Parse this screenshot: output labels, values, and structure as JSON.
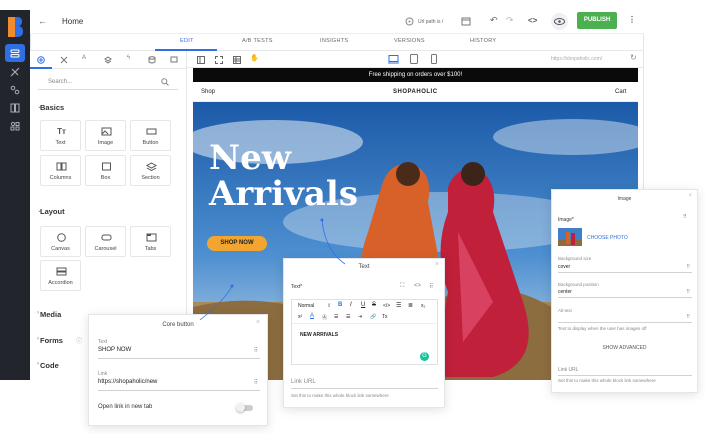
{
  "topbar": {
    "back_arrow": "←",
    "home": "Home",
    "url_path": "Url path is /",
    "publish": "PUBLISH"
  },
  "tabs": [
    "EDIT",
    "A/B TESTS",
    "INSIGHTS",
    "VERSIONS",
    "HISTORY"
  ],
  "preview_url": "https://shopaholic.com/",
  "search": {
    "placeholder": "Search..."
  },
  "basics": {
    "title": "Basics",
    "items": [
      "Text",
      "Image",
      "Button",
      "Columns",
      "Box",
      "Section"
    ]
  },
  "layout": {
    "title": "Layout",
    "items": [
      "Canvas",
      "Carousel",
      "Tabs",
      "Accordion"
    ]
  },
  "sections": [
    "Media",
    "Forms",
    "Code"
  ],
  "site": {
    "banner": "Free shipping on orders over $100!",
    "nav_left": "Shop",
    "brand": "SHOPAHOLIC",
    "nav_right": "Cart",
    "headline_1": "New",
    "headline_2": "Arrivals",
    "cta": "SHOP NOW"
  },
  "core_button": {
    "title": "Core button",
    "text_label": "Text",
    "text_value": "SHOP NOW",
    "link_label": "Link",
    "link_value": "https://shopaholic/new",
    "toggle_label": "Open link in new tab"
  },
  "text_panel": {
    "title": "Text",
    "field_label": "Text*",
    "style_select": "Normal",
    "content": "NEW ARRIVALS",
    "link_placeholder": "Link URL",
    "link_help": "Set this to make this whole block link somewhere"
  },
  "image_panel": {
    "title": "Image",
    "image_label": "Image*",
    "choose": "CHOOSE PHOTO",
    "bg_size_label": "Background size",
    "bg_size": "cover",
    "bg_pos_label": "Background position",
    "bg_pos": "center",
    "alt_label": "Alt text",
    "alt_help": "Text to display when the user has images off",
    "advanced": "SHOW ADVANCED",
    "link_placeholder": "Link URL",
    "link_help": "Set this to make this whole block link somewhere"
  },
  "colors": {
    "accent": "#2f6fe4",
    "publish": "#4caf50",
    "cta": "#f2a531",
    "rail": "#22252b"
  }
}
